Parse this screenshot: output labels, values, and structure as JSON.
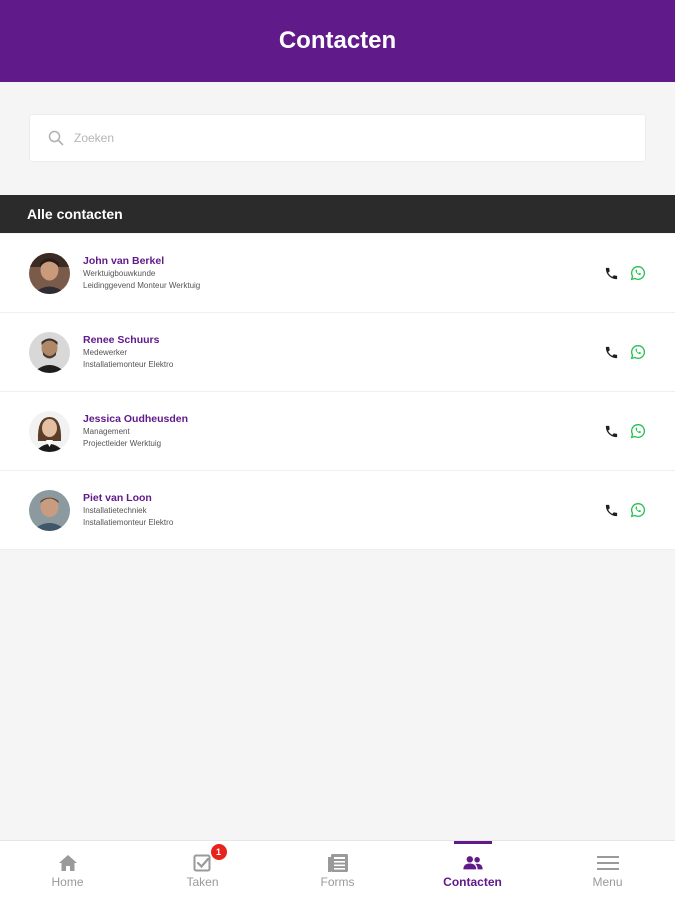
{
  "header": {
    "title": "Contacten"
  },
  "search": {
    "placeholder": "Zoeken",
    "value": ""
  },
  "section": {
    "title": "Alle contacten"
  },
  "contacts": [
    {
      "name": "John van Berkel",
      "line1": "Werktuigbouwkunde",
      "line2": "Leidinggevend Monteur Werktuig"
    },
    {
      "name": "Renee Schuurs",
      "line1": "Medewerker",
      "line2": "Installatiemonteur Elektro"
    },
    {
      "name": "Jessica Oudheusden",
      "line1": "Management",
      "line2": "Projectleider Werktuig"
    },
    {
      "name": "Piet van Loon",
      "line1": "Installatietechniek",
      "line2": "Installatiemonteur Elektro"
    }
  ],
  "tabbar": {
    "tabs": [
      {
        "label": "Home",
        "icon": "home-icon"
      },
      {
        "label": "Taken",
        "icon": "tasks-icon",
        "badge": "1"
      },
      {
        "label": "Forms",
        "icon": "forms-icon"
      },
      {
        "label": "Contacten",
        "icon": "contacts-icon",
        "active": true
      },
      {
        "label": "Menu",
        "icon": "menu-icon"
      }
    ]
  },
  "colors": {
    "brand": "#611a8a",
    "section_bar": "#2b2b2b",
    "whatsapp": "#25c152",
    "badge": "#e8231c",
    "inactive_tab": "#9a9a9a"
  }
}
